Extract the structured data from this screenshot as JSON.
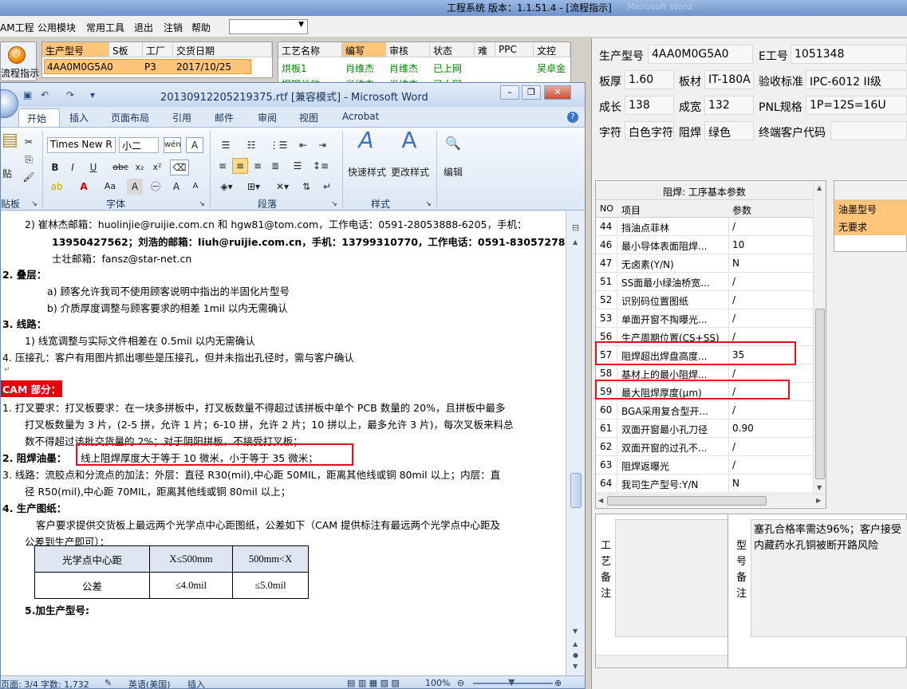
{
  "app": {
    "title": "工程系统   版本：1.1.51.4 - [流程指示]",
    "title_ghost": "Microsoft Word",
    "menu": [
      "AM工程",
      "公用模块",
      "常用工具",
      "退出",
      "注销",
      "帮助"
    ],
    "menu_combo_value": "",
    "flow_button": "流程指示"
  },
  "order_grid": {
    "headers": [
      "生产型号",
      "S板",
      "工厂",
      "交货日期"
    ],
    "row": [
      "4AA0M0G5A0",
      "",
      "P3",
      "2017/10/25"
    ]
  },
  "process_grid": {
    "headers": [
      "工艺名称",
      "编写",
      "审核",
      "状态",
      "难",
      "PPC",
      "文控"
    ],
    "rows": [
      [
        "烘板1",
        "肖维杰",
        "肖维杰",
        "已上网",
        "",
        "",
        "吴卓金"
      ],
      [
        "揭铜丝效",
        "肖维杰",
        "肖维杰",
        "已上网",
        "",
        "",
        ""
      ]
    ]
  },
  "fields": {
    "model_label": "生产型号",
    "model_value": "4AA0M0G5A0",
    "e_label": "E工号",
    "e_value": "1051348",
    "thick_label": "板厚",
    "thick_value": "1.60",
    "mat_label": "板材",
    "mat_value": "IT-180A",
    "std_label": "验收标准",
    "std_value": "IPC-6012 II级",
    "len_label": "成长",
    "len_value": "138",
    "wid_label": "成宽",
    "wid_value": "132",
    "pnl_label": "PNL规格",
    "pnl_value": "1P=12S=16U",
    "char_label": "字符",
    "char_value": "白色字符",
    "mask_label": "阻焊",
    "mask_value": "绿色",
    "cust_label": "终端客户代码",
    "cust_value": ""
  },
  "solder_panel": {
    "title": "阻焊: 工序基本参数",
    "headers": [
      "NO",
      "项目",
      "参数"
    ],
    "rows": [
      {
        "no": "44",
        "item": "挡油点菲林",
        "param": "/"
      },
      {
        "no": "46",
        "item": "最小导体表面阻焊...",
        "param": "10"
      },
      {
        "no": "47",
        "item": "无卤素(Y/N)",
        "param": "N"
      },
      {
        "no": "51",
        "item": "SS面最小绿油桥宽...",
        "param": "/"
      },
      {
        "no": "52",
        "item": "识别码位置图纸",
        "param": "/"
      },
      {
        "no": "53",
        "item": "单面开窗不掏曝光...",
        "param": "/"
      },
      {
        "no": "56",
        "item": "生产周期位置(CS+SS)",
        "param": "/"
      },
      {
        "no": "57",
        "item": "阻焊超出焊盘高度...",
        "param": "35"
      },
      {
        "no": "58",
        "item": "基材上的最小阻焊...",
        "param": "/"
      },
      {
        "no": "59",
        "item": "最大阻焊厚度(μm)",
        "param": "/"
      },
      {
        "no": "60",
        "item": "BGA采用复合型开...",
        "param": "/"
      },
      {
        "no": "61",
        "item": "双面开窗最小孔刀径",
        "param": "0.90"
      },
      {
        "no": "62",
        "item": "双面开窗的过孔不...",
        "param": "/"
      },
      {
        "no": "63",
        "item": "阻焊返曝光",
        "param": "/"
      },
      {
        "no": "64",
        "item": "我司生产型号:Y/N",
        "param": "N"
      }
    ]
  },
  "ink_panel": {
    "header": "油墨型号",
    "value": "无要求"
  },
  "notes": {
    "process_note_label": "工艺备注",
    "model_note_label": "型号备注",
    "model_note_text": "塞孔合格率需达96%；客户接受内藏药水孔铜被断开路风险"
  },
  "word": {
    "title": "20130912205219375.rtf [兼容模式] - Microsoft Word",
    "tabs": [
      "开始",
      "插入",
      "页面布局",
      "引用",
      "邮件",
      "审阅",
      "视图",
      "Acrobat"
    ],
    "font_name": "Times New R",
    "font_size": "小二",
    "groups": [
      "贴板",
      "字体",
      "段落",
      "样式"
    ],
    "style_buttons": [
      "快速样式",
      "更改样式",
      "编辑"
    ],
    "paste_label": "贴",
    "doc": {
      "l1": "2)    崔林杰邮箱：huolinjie@ruijie.com.cn 和 hgw81@tom.com，工作电话：0591-28053888-6205，手机：",
      "l2": "13950427562；刘浩的邮箱：liuh@ruijie.com.cn，手机：13799310770，工作电话：0591-83057278；范",
      "l3": "士壮邮箱：fansz@star-net.cn",
      "s2": "2.   叠层：",
      "s2a": "a)   顾客允许我司不使用顾客说明中指出的半固化片型号",
      "s2b": "b)   介质厚度调整与顾客要求的相差 1mil 以内无需确认",
      "s3": "3.   线路：",
      "s3a": "1) 线宽调整与实际文件相差在 0.5mil 以内无需确认",
      "s4": "4.   压接孔：客户有用图片抓出哪些是压接孔，但并未指出孔径时，需与客户确认",
      "cam": "CAM 部分：",
      "c1a": "1.   打叉要求：打叉板要求：在一块多拼板中，打叉板数量不得超过该拼板中单个 PCB 数量的 20%，且拼板中最多",
      "c1b": "打叉板数量为 3 片，(2-5 拼，允许 1 片；6-10 拼，允许 2 片；10 拼以上，最多允许 3 片)，每次叉板来料总",
      "c1c": "数不得超过该批交货量的 2%；对于阴阳拼板，不接受打叉板；",
      "c2_label": "2.   阻焊油墨：",
      "c2_text": "线上阻焊厚度大于等于 10 微米，小于等于 35 微米；",
      "c3a": "3.   线路：流胶点和分流点的加法：外层：直径 R30(mil),中心距 50MIL，距离其他线或铜 80mil 以上；内层：直",
      "c3b": "径 R50(mil),中心距 70MIL，距离其他线或铜 80mil 以上；",
      "c4": "4.   生产图纸：",
      "c4a": "客户要求提供交货板上最远两个光学点中心距图纸，公差如下（CAM 提供标注有最远两个光学点中心距及",
      "c4b": "公差到生产即可）：",
      "table": [
        [
          "光学点中心距",
          "X≤500mm",
          "500mm<X"
        ],
        [
          "公差",
          "≤4.0mil",
          "≤5.0mil"
        ]
      ],
      "c5": "5.加生产型号:"
    },
    "status": {
      "page": "页面: 3/4",
      "words": "字数: 1,732",
      "lang": "英语(美国)",
      "mode": "插入",
      "zoom": "100%"
    }
  }
}
